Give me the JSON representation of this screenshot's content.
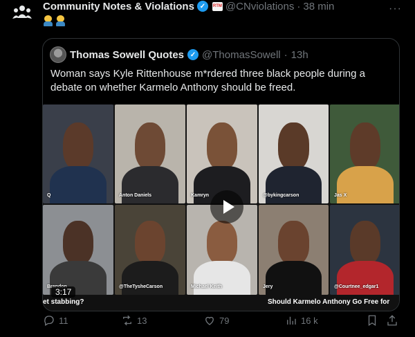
{
  "post": {
    "author_name": "Community Notes & Violations",
    "handle": "@CNviolations",
    "separator": "·",
    "time": "38 min",
    "affiliate_badge_text": "RTM",
    "emoji_text": "🤦‍♂️🤦‍♂️"
  },
  "quote": {
    "author_name": "Thomas Sowell Quotes",
    "handle": "@ThomasSowell",
    "separator": "·",
    "time": "13h",
    "text": "Woman says Kyle Rittenhouse m*rdered three black people during a debate on whether Karmelo Anthony should be freed."
  },
  "video": {
    "participants": [
      {
        "label": "Q"
      },
      {
        "label": "Anton Daniels"
      },
      {
        "label": "Kamryn"
      },
      {
        "label": "@bykingcarson"
      },
      {
        "label": "Jas X"
      },
      {
        "label": "Brandon"
      },
      {
        "label": "@TheTysheCarson"
      },
      {
        "label": "Michael Keith"
      },
      {
        "label": "Jery"
      },
      {
        "label": "@Courtnee_edgar1"
      }
    ],
    "caption_left": "et stabbing?",
    "caption_right": "Should Karmelo Anthony Go Free for",
    "duration": "3:17"
  },
  "actions": {
    "replies": "11",
    "reposts": "13",
    "likes": "79",
    "views": "16 k"
  }
}
